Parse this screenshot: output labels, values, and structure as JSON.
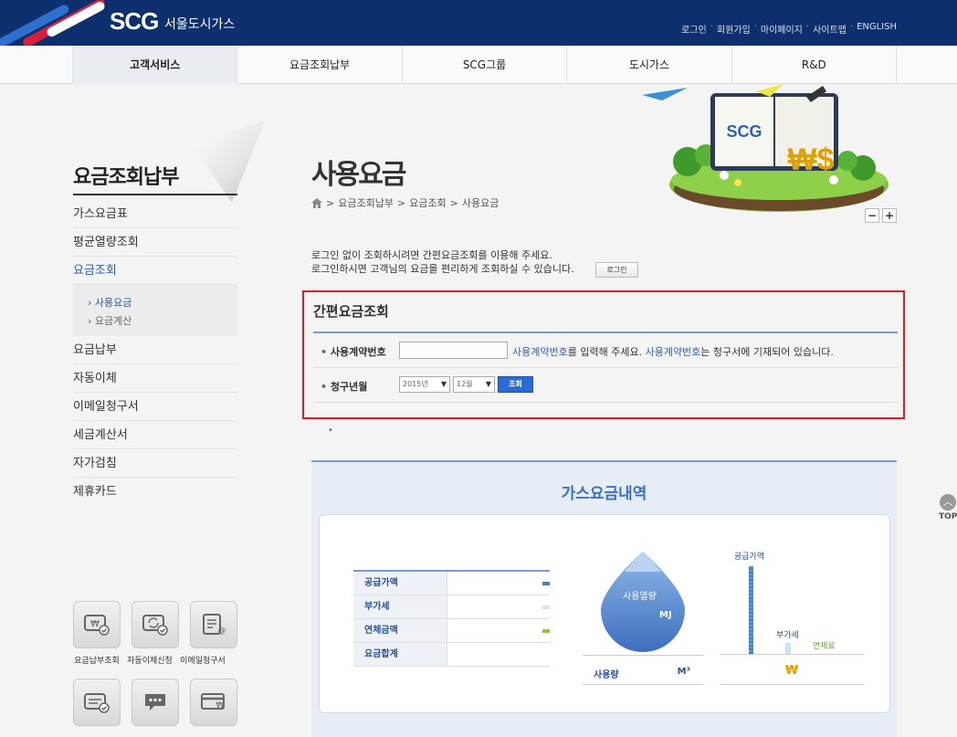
{
  "header": {
    "logo": "SCG",
    "logo_sub": "서울도시가스",
    "links": [
      "로그인",
      "회원가입",
      "마이페이지",
      "사이트맵",
      "ENGLISH"
    ]
  },
  "nav": [
    "고객서비스",
    "요금조회납부",
    "SCG그룹",
    "도시가스",
    "R&D"
  ],
  "sidebar": {
    "title": "요금조회납부",
    "items": [
      "가스요금표",
      "평균열량조회",
      "요금조회"
    ],
    "sub_items": [
      "사용요금",
      "요금계산"
    ],
    "items_after": [
      "요금납부",
      "자동이체",
      "이메일청구서",
      "세금계산서",
      "자가검침",
      "제휴카드"
    ],
    "quick_labels": [
      "요금납부조회",
      "자동이체신청",
      "이메일청구서"
    ]
  },
  "main": {
    "page_title": "사용요금",
    "breadcrumb": [
      "요금조회납부",
      "요금조회",
      "사용요금"
    ],
    "zoom_out": "−",
    "zoom_in": "+",
    "notice_line1": "로그인 없이 조회하시려면 간편요금조회를 이용해 주세요.",
    "notice_line2": "로그인하시면 고객님의 요금을 편리하게 조회하실 수 있습니다.",
    "login_button": "로그인"
  },
  "quick_search": {
    "title": "간편요금조회",
    "contract_label": "사용계약번호",
    "contract_value": "",
    "hint_link1": "사용계약번호",
    "hint_mid": "를 입력해 주세요.",
    "hint_link2": "사용계약번호",
    "hint_end": "는 청구서에 기재되어 있습니다.",
    "period_label": "청구년월",
    "year_value": "2015년",
    "month_value": "12월",
    "search_button": "조회"
  },
  "history": {
    "title": "가스요금내역",
    "fee_rows": [
      "공급가액",
      "부가세",
      "연체금액",
      "요금합계"
    ],
    "drop_label": "사용열량",
    "drop_unit": "MJ",
    "usage_label": "사용량",
    "usage_unit": "M³",
    "bar_labels": [
      "공급가액",
      "부가세",
      "연체료"
    ],
    "currency": "₩",
    "colors": {
      "supply": "#3f7fc9",
      "vat": "#cfe3f2",
      "late": "#8cc63e"
    }
  },
  "top_button": "TOP"
}
